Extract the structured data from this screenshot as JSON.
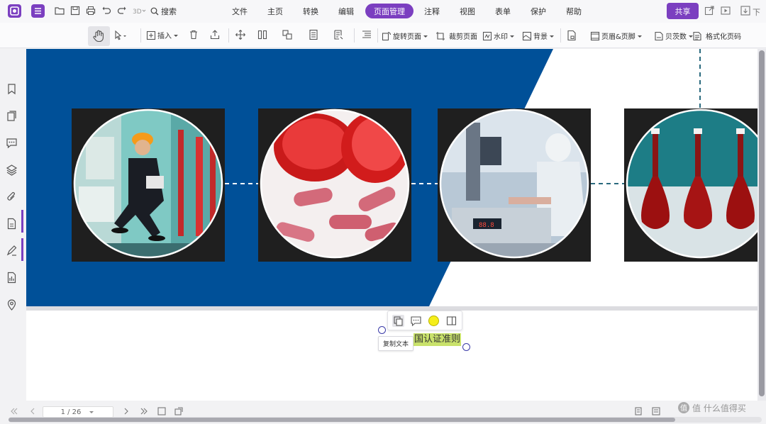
{
  "menubar": {
    "search_label": "搜索",
    "items": [
      "文件",
      "主页",
      "转换",
      "编辑",
      "页面管理",
      "注释",
      "视图",
      "表单",
      "保护",
      "帮助"
    ],
    "active": "页面管理",
    "share_label": "共享",
    "download_label": "下"
  },
  "toolbar": {
    "insert": "插入",
    "rotate": "旋转页面",
    "crop": "裁剪页面",
    "watermark": "水印",
    "background": "背景",
    "header_footer": "页眉&页脚",
    "bates": "贝茨数",
    "format_page_number": "格式化页码"
  },
  "selection": {
    "tooltip": "复制文本",
    "text": "国认证准则"
  },
  "pager": {
    "value": "1 / 26"
  },
  "watermark": {
    "text": "值 什么值得买"
  },
  "colors": {
    "accent": "#7b3fc0",
    "banner_blue": "#005098",
    "highlight": "#c9e26b"
  },
  "icons": {
    "sidebar": [
      "bookmark-icon",
      "pages-icon",
      "comment-icon",
      "layers-icon",
      "attachment-icon",
      "document-icon",
      "signature-icon",
      "report-icon",
      "location-icon"
    ]
  }
}
